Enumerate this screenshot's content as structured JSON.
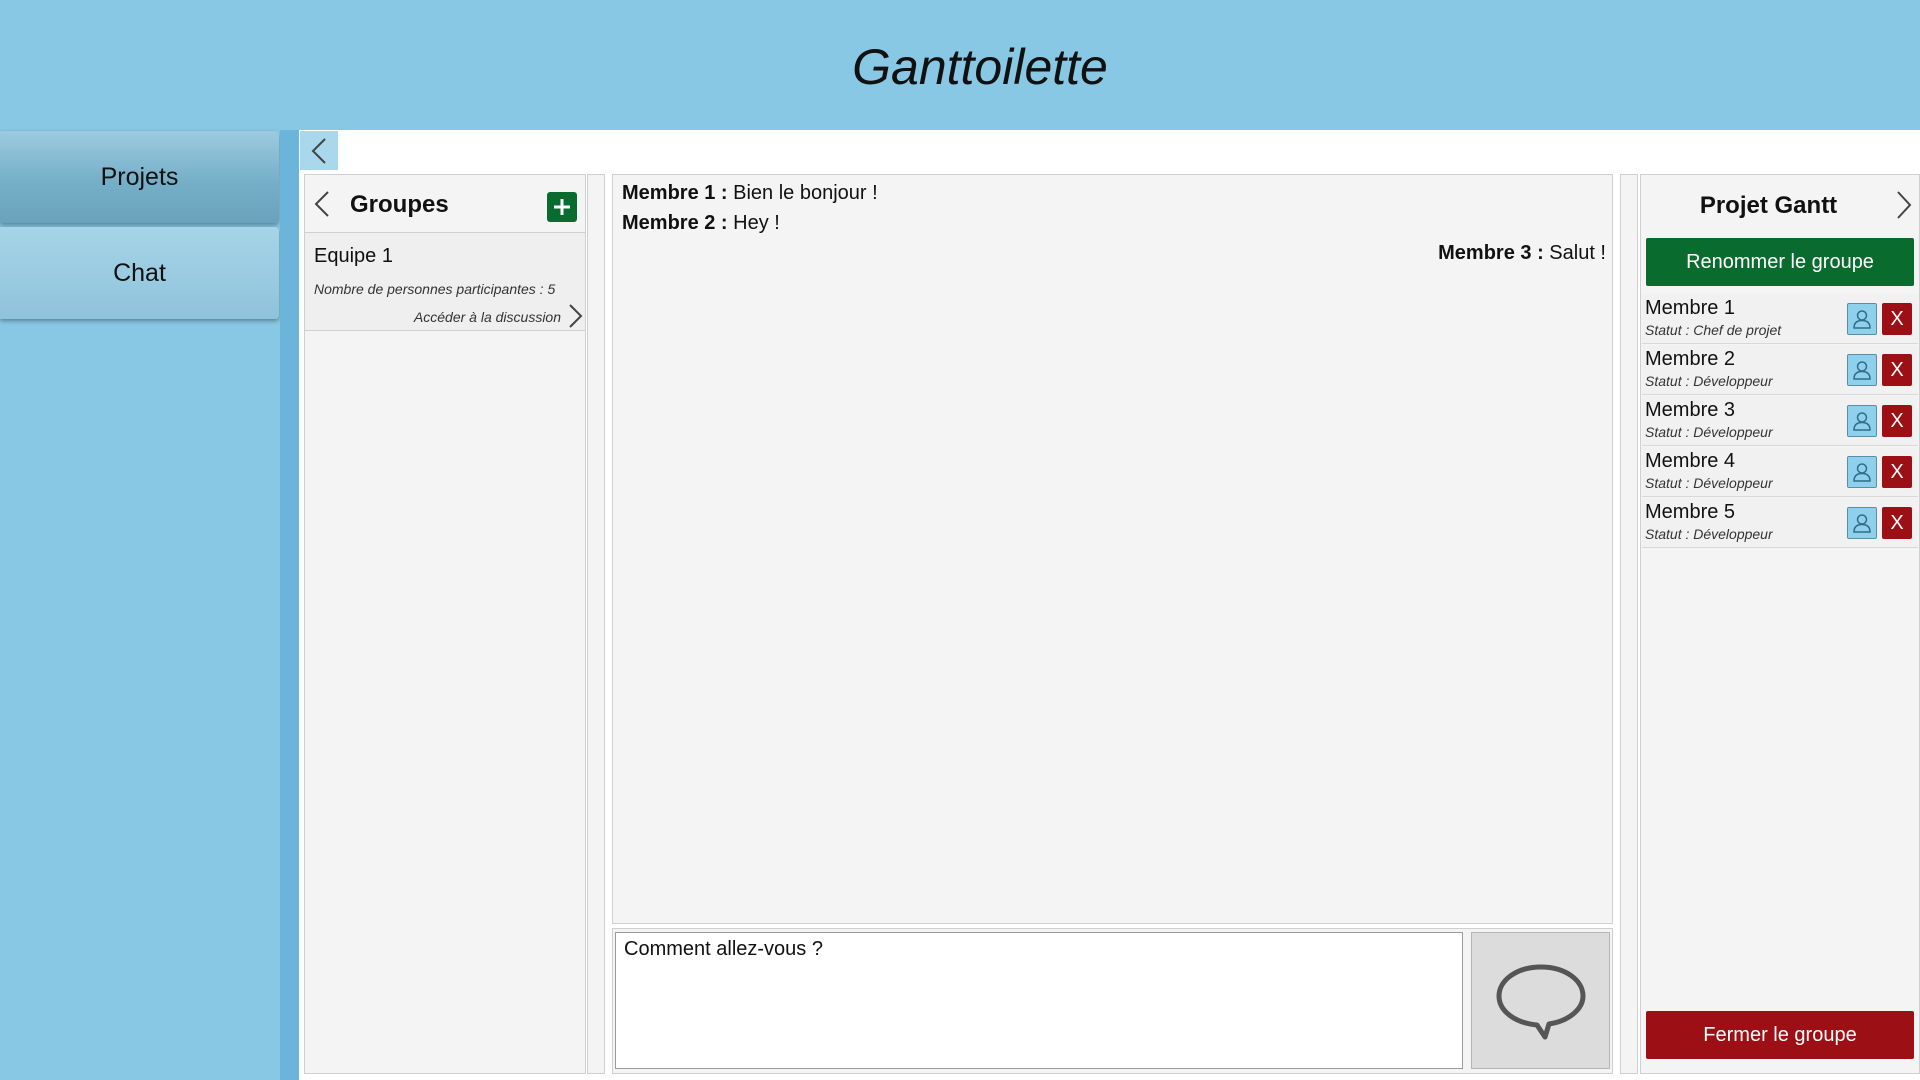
{
  "app": {
    "title": "Ganttoilette"
  },
  "nav": {
    "projets_label": "Projets",
    "chat_label": "Chat"
  },
  "groups": {
    "title": "Groupes",
    "items": [
      {
        "name": "Equipe 1",
        "participants": "Nombre de personnes participantes : 5",
        "access_label": "Accéder à la discussion"
      }
    ]
  },
  "chat": {
    "messages": [
      {
        "author": "Membre 1 :",
        "text": " Bien le bonjour !",
        "align": "left"
      },
      {
        "author": "Membre 2 :",
        "text": " Hey !",
        "align": "left"
      },
      {
        "author": "Membre 3 :",
        "text": " Salut !",
        "align": "right"
      }
    ],
    "composer_value": "Comment allez-vous ?"
  },
  "project": {
    "title": "Projet Gantt",
    "rename_label": "Renommer le groupe",
    "close_label": "Fermer le groupe",
    "remove_label": "X",
    "members": [
      {
        "name": "Membre 1",
        "status": "Statut : Chef de projet"
      },
      {
        "name": "Membre 2",
        "status": "Statut : Développeur"
      },
      {
        "name": "Membre 3",
        "status": "Statut : Développeur"
      },
      {
        "name": "Membre 4",
        "status": "Statut : Développeur"
      },
      {
        "name": "Membre 5",
        "status": "Statut : Développeur"
      }
    ]
  },
  "colors": {
    "background": "#88c8e4",
    "accent_green": "#0a6b2e",
    "accent_red": "#9c0f14",
    "side_strip": "#6bb5da"
  },
  "icons": {
    "collapse": "chevron-left-icon",
    "add": "plus-icon",
    "access": "chevron-right-icon",
    "send": "speech-bubble-icon",
    "profile": "user-icon"
  }
}
